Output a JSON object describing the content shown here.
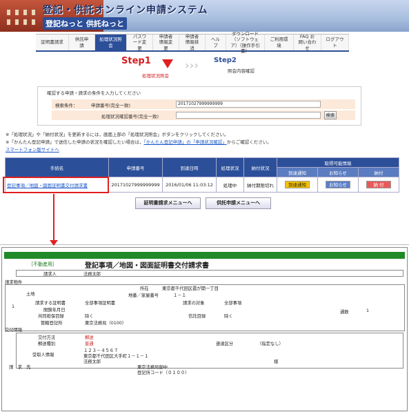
{
  "header": {
    "title": "登記・供託オンライン申請システム",
    "subtitle": "登記ねっと 供託ねっと"
  },
  "nav": [
    "証明書請求",
    "供託申請",
    "処理状況照会",
    "パスワード変更",
    "申請者情報変更",
    "申請者情報抹消",
    "ヘルプ",
    "ダウンロード（ソフトウェア）（操作手引書）",
    "ご利用環境",
    "FAQ お問い合わせ",
    "ログアウト"
  ],
  "steps": {
    "step1": "Step1",
    "step1_label": "処理状況照会",
    "step2": "Step2",
    "step2_label": "照会内容確認"
  },
  "search": {
    "title": "確認する申請・請求の条件を入力してください",
    "cond_label": "検索条件：",
    "app_no_label": "申請番号(完全一致)",
    "app_no_value": "20171027999999999",
    "proc_no_label": "処理状況確認番号(完全一致)",
    "proc_no_value": "",
    "search_button": "検索"
  },
  "notes": {
    "n1": "※「処理状況」や「納付状況」を更新するには，画面上部の「処理状況照会」ボタンをクリックしてください。",
    "n2a": "※「かんたん登記申請」で送信した申請の状況を確認したい場合は，",
    "n2link": "「かんたん登記申請」の「申請状況確認」",
    "n2b": "からご確認ください。",
    "smartphone": "スマートフォン版サイトへ"
  },
  "table": {
    "headers": [
      "手続名",
      "申請番号",
      "到達日時",
      "処理状況",
      "納付状況",
      "取得可能情報"
    ],
    "subheaders": [
      "到達通知",
      "お知らせ",
      "納付"
    ],
    "row": {
      "name": "登記事項／地図・図面証明書交付請求書",
      "app_no": "20171027999999999",
      "arrived": "2016/01/06 11:03:12",
      "status": "処理中",
      "payment": "納付期限切れ",
      "b1": "到達通知",
      "b2": "お知らせ",
      "b3": "納 付"
    }
  },
  "bottom_buttons": {
    "cert": "証明書請求メニューへ",
    "deposit": "供託申請メニューへ"
  },
  "form": {
    "tag": "［不動産用］",
    "title": "登記事項／地図・図面証明書交付請求書",
    "applicant_label": "請求人",
    "applicant_value": "法務太郎",
    "request_items": "請求物件",
    "col1": "1",
    "land": "土地",
    "loc_label": "所在",
    "loc_value": "東京都千代田区霞が関一丁目",
    "num_label": "地番／家屋番号",
    "num_value": "１－１",
    "cert_type_label": "請求する証明書",
    "cert_type_value": "全部事項証明書",
    "target_label": "請求の対象",
    "target_value": "全部事項",
    "closed_label": "閉鎖年月日",
    "closed_value": "",
    "joint_label": "共同担保目録",
    "joint_value": "除く",
    "trust_label": "信託目録",
    "trust_value": "除く",
    "office_label": "管轄登記所",
    "office_value": "東京法務局（0100）",
    "copies_label": "通数",
    "copies_value": "1",
    "delivery": "交付情報",
    "method_label": "交付方法",
    "method_value": "郵送",
    "mail_label": "郵送種別",
    "mail_value": "普通",
    "express_label": "速達区分",
    "express_value": "（指定なし）",
    "recipient_label": "受取人情報",
    "zip": "１２３－４５６７",
    "addr": "東京都千代田区大手町１－１－１",
    "name": "法務太郎",
    "sama": "様",
    "dest_label": "請　求　先",
    "dest_value": "東京法務局御中",
    "dest_code": "登記所コード（０１００）"
  }
}
